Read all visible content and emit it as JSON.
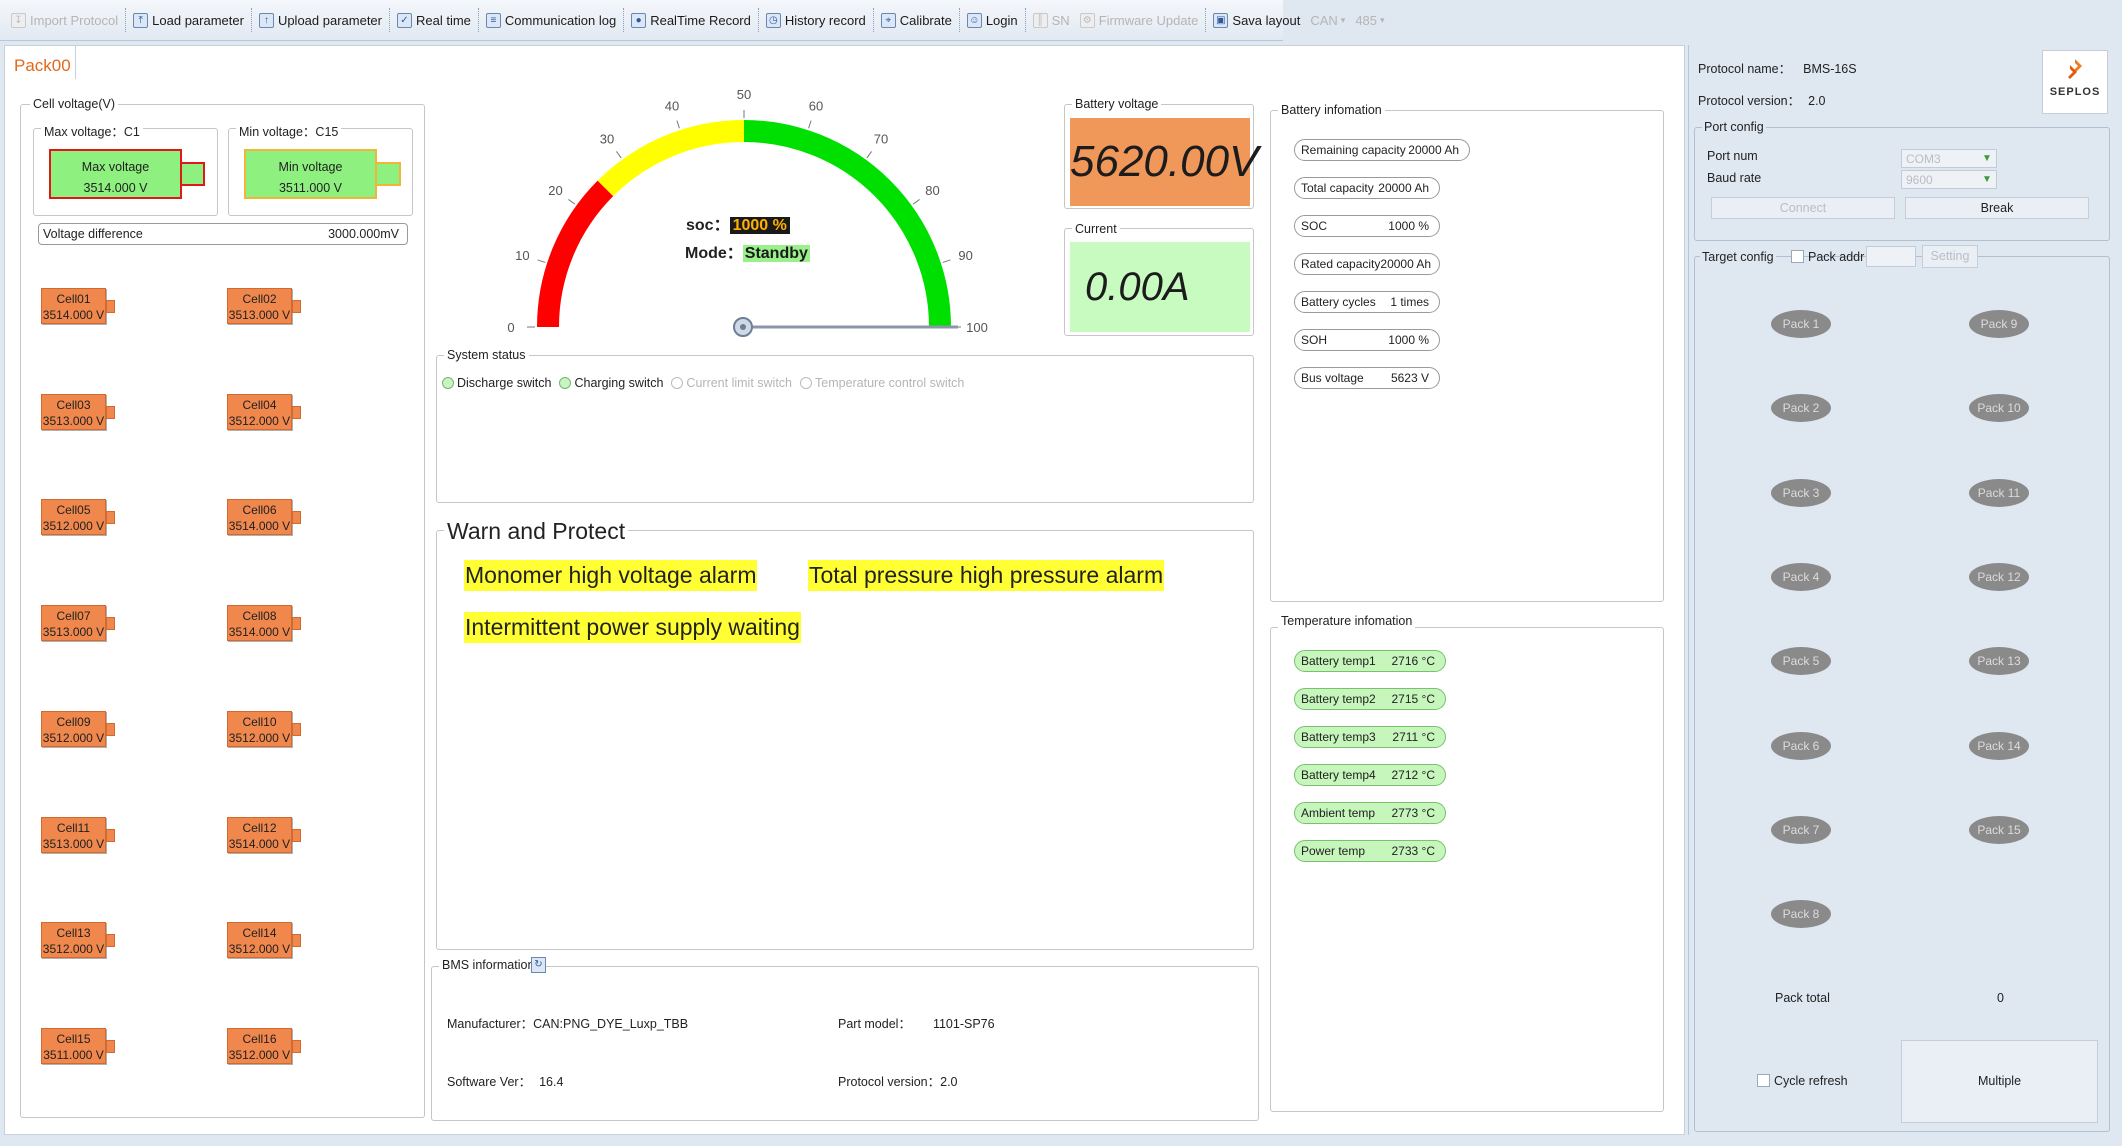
{
  "toolbar": {
    "items": [
      {
        "label": "Import Protocol",
        "icon": "import-icon",
        "enabled": false
      },
      {
        "label": "Load parameter",
        "icon": "load-icon",
        "enabled": true
      },
      {
        "label": "Upload parameter",
        "icon": "upload-icon",
        "enabled": true
      },
      {
        "label": "Real time",
        "icon": "checkbox-icon",
        "enabled": true
      },
      {
        "label": "Communication log",
        "icon": "log-icon",
        "enabled": true
      },
      {
        "label": "RealTime Record",
        "icon": "record-icon",
        "enabled": true
      },
      {
        "label": "History record",
        "icon": "history-icon",
        "enabled": true
      },
      {
        "label": "Calibrate",
        "icon": "calibrate-icon",
        "enabled": true
      },
      {
        "label": "Login",
        "icon": "user-icon",
        "enabled": true
      },
      {
        "label": "SN",
        "icon": "barcode-icon",
        "enabled": false
      },
      {
        "label": "Firmware Update",
        "icon": "firmware-icon",
        "enabled": false
      },
      {
        "label": "Sava layout",
        "icon": "save-icon",
        "enabled": true
      },
      {
        "label": "CAN",
        "icon": "can-icon",
        "enabled": false
      },
      {
        "label": "485",
        "icon": "rs485-icon",
        "enabled": false
      }
    ]
  },
  "tab": {
    "label": "Pack00"
  },
  "cell_voltage": {
    "title": "Cell voltage(V)",
    "max_group": "Max voltage：C1",
    "max_label": "Max voltage",
    "max_value": "3514.000 V",
    "min_group": "Min voltage：C15",
    "min_label": "Min voltage",
    "min_value": "3511.000 V",
    "diff_label": "Voltage difference",
    "diff_value": "3000.000mV",
    "cells": [
      {
        "name": "Cell01",
        "value": "3514.000 V"
      },
      {
        "name": "Cell02",
        "value": "3513.000 V"
      },
      {
        "name": "Cell03",
        "value": "3513.000 V"
      },
      {
        "name": "Cell04",
        "value": "3512.000 V"
      },
      {
        "name": "Cell05",
        "value": "3512.000 V"
      },
      {
        "name": "Cell06",
        "value": "3514.000 V"
      },
      {
        "name": "Cell07",
        "value": "3513.000 V"
      },
      {
        "name": "Cell08",
        "value": "3514.000 V"
      },
      {
        "name": "Cell09",
        "value": "3512.000 V"
      },
      {
        "name": "Cell10",
        "value": "3512.000 V"
      },
      {
        "name": "Cell11",
        "value": "3513.000 V"
      },
      {
        "name": "Cell12",
        "value": "3514.000 V"
      },
      {
        "name": "Cell13",
        "value": "3512.000 V"
      },
      {
        "name": "Cell14",
        "value": "3512.000 V"
      },
      {
        "name": "Cell15",
        "value": "3511.000 V"
      },
      {
        "name": "Cell16",
        "value": "3512.000 V"
      }
    ]
  },
  "gauge": {
    "ticks": [
      "0",
      "10",
      "20",
      "30",
      "40",
      "50",
      "60",
      "70",
      "80",
      "90",
      "100"
    ],
    "soc_label": "soc：",
    "soc_value": "1000 %",
    "mode_label": "Mode：",
    "mode_value": "Standby",
    "colors": {
      "red": "#ff0000",
      "yellow": "#ffff00",
      "green": "#00e000"
    }
  },
  "battery_voltage": {
    "title": "Battery voltage",
    "value": "5620.00V",
    "color": "#f0975a"
  },
  "current": {
    "title": "Current",
    "value": "0.00A",
    "color": "#c8fbc0"
  },
  "system_status": {
    "title": "System status",
    "switches": [
      {
        "label": "Discharge switch",
        "on": true
      },
      {
        "label": "Charging switch",
        "on": true
      },
      {
        "label": "Current limit switch",
        "on": false
      },
      {
        "label": "Temperature control switch",
        "on": false
      }
    ]
  },
  "warn": {
    "title": "Warn and Protect",
    "items": [
      "Monomer high voltage alarm",
      "Total pressure high pressure alarm",
      "Intermittent power supply waiting"
    ]
  },
  "bms": {
    "title": "BMS information",
    "manufacturer_label": "Manufacturer：",
    "manufacturer_value": "CAN:PNG_DYE_Luxp_TBB",
    "part_label": "Part model：",
    "part_value": "1101-SP76",
    "software_label": "Software Ver：",
    "software_value": "16.4",
    "protocol_label": "Protocol version：",
    "protocol_value": "2.0"
  },
  "battery_info": {
    "title": "Battery infomation",
    "items": [
      {
        "label": "Remaining capacity",
        "value": "20000 Ah"
      },
      {
        "label": "Total capacity",
        "value": "20000 Ah"
      },
      {
        "label": "SOC",
        "value": "1000 %"
      },
      {
        "label": "Rated capacity",
        "value": "20000 Ah"
      },
      {
        "label": "Battery cycles",
        "value": "1 times"
      },
      {
        "label": "SOH",
        "value": "1000 %"
      },
      {
        "label": "Bus voltage",
        "value": "5623 V"
      }
    ]
  },
  "temp_info": {
    "title": "Temperature infomation",
    "items": [
      {
        "label": "Battery temp1",
        "value": "2716 °C"
      },
      {
        "label": "Battery temp2",
        "value": "2715 °C"
      },
      {
        "label": "Battery temp3",
        "value": "2711 °C"
      },
      {
        "label": "Battery temp4",
        "value": "2712 °C"
      },
      {
        "label": "Ambient temp",
        "value": "2773 °C"
      },
      {
        "label": "Power temp",
        "value": "2733 °C"
      }
    ]
  },
  "right": {
    "protocol_name_label": "Protocol name：",
    "protocol_name_value": "BMS-16S",
    "protocol_version_label": "Protocol version：",
    "protocol_version_value": "2.0",
    "logo_text": "SEPLOS",
    "port_config_title": "Port config",
    "port_num_label": "Port num",
    "port_num_value": "COM3",
    "baud_label": "Baud rate",
    "baud_value": "9600",
    "connect_label": "Connect",
    "break_label": "Break",
    "target_config_title": "Target config",
    "pack_addr_label": "Pack addr",
    "setting_label": "Setting",
    "packs_left": [
      "Pack 1",
      "Pack 2",
      "Pack 3",
      "Pack 4",
      "Pack 5",
      "Pack 6",
      "Pack 7",
      "Pack 8"
    ],
    "packs_right": [
      "Pack 9",
      "Pack 10",
      "Pack 11",
      "Pack 12",
      "Pack 13",
      "Pack 14",
      "Pack 15"
    ],
    "pack_total_label": "Pack total",
    "pack_total_value": "0",
    "cycle_refresh_label": "Cycle refresh",
    "multiple_label": "Multiple"
  }
}
